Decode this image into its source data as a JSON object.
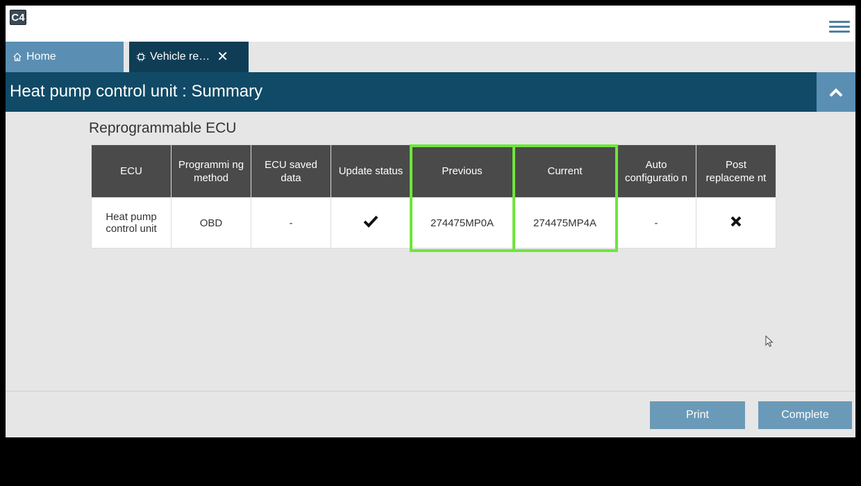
{
  "app": {
    "logo": "C4"
  },
  "tabs": [
    {
      "label": "Home",
      "icon": "home-icon"
    },
    {
      "label": "Vehicle re…",
      "icon": "chip-icon"
    }
  ],
  "header": {
    "title": "Heat pump control unit : Summary"
  },
  "section": {
    "title": "Reprogrammable ECU"
  },
  "table": {
    "columns": [
      "ECU",
      "Programmi ng method",
      "ECU saved data",
      "Update status",
      "Previous",
      "Current",
      "Auto configuratio n",
      "Post replaceme nt"
    ],
    "rows": [
      {
        "ecu": "Heat pump control unit",
        "method": "OBD",
        "saved_data": "-",
        "update_status": "check-icon",
        "previous": "274475MP0A",
        "current": "274475MP4A",
        "auto_config": "-",
        "post_replacement": "cross-icon"
      }
    ]
  },
  "buttons": {
    "print": "Print",
    "complete": "Complete"
  },
  "colors": {
    "highlight": "#6ee63a",
    "title_bar": "#104a66",
    "accent": "#5a8fb3"
  }
}
